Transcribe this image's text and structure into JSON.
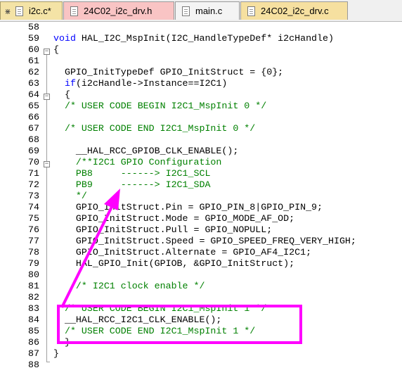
{
  "tabs": [
    {
      "label": "i2c.c*",
      "color": "#f4e3a6",
      "active": true
    },
    {
      "label": "24C02_i2c_drv.h",
      "color": "#f9c4c4"
    },
    {
      "label": "main.c",
      "color": "#f4f4f4"
    },
    {
      "label": "24C02_i2c_drv.c",
      "color": "#f6e0a0"
    }
  ],
  "lines": [
    {
      "n": "58",
      "code": ""
    },
    {
      "n": "59",
      "code": "void HAL_I2C_MspInit(I2C_HandleTypeDef* i2cHandle)"
    },
    {
      "n": "60",
      "code": "{"
    },
    {
      "n": "61",
      "code": ""
    },
    {
      "n": "62",
      "code": "  GPIO_InitTypeDef GPIO_InitStruct = {0};"
    },
    {
      "n": "63",
      "code": "  if(i2cHandle->Instance==I2C1)"
    },
    {
      "n": "64",
      "code": "  {"
    },
    {
      "n": "65",
      "code": "  /* USER CODE BEGIN I2C1_MspInit 0 */"
    },
    {
      "n": "66",
      "code": ""
    },
    {
      "n": "67",
      "code": "  /* USER CODE END I2C1_MspInit 0 */"
    },
    {
      "n": "68",
      "code": ""
    },
    {
      "n": "69",
      "code": "    __HAL_RCC_GPIOB_CLK_ENABLE();"
    },
    {
      "n": "70",
      "code": "    /**I2C1 GPIO Configuration"
    },
    {
      "n": "71",
      "code": "    PB8     ------> I2C1_SCL"
    },
    {
      "n": "72",
      "code": "    PB9     ------> I2C1_SDA"
    },
    {
      "n": "73",
      "code": "    */"
    },
    {
      "n": "74",
      "code": "    GPIO_InitStruct.Pin = GPIO_PIN_8|GPIO_PIN_9;"
    },
    {
      "n": "75",
      "code": "    GPIO_InitStruct.Mode = GPIO_MODE_AF_OD;"
    },
    {
      "n": "76",
      "code": "    GPIO_InitStruct.Pull = GPIO_NOPULL;"
    },
    {
      "n": "77",
      "code": "    GPIO_InitStruct.Speed = GPIO_SPEED_FREQ_VERY_HIGH;"
    },
    {
      "n": "78",
      "code": "    GPIO_InitStruct.Alternate = GPIO_AF4_I2C1;"
    },
    {
      "n": "79",
      "code": "    HAL_GPIO_Init(GPIOB, &GPIO_InitStruct);"
    },
    {
      "n": "80",
      "code": ""
    },
    {
      "n": "81",
      "code": "    /* I2C1 clock enable */"
    },
    {
      "n": "82",
      "code": ""
    },
    {
      "n": "83",
      "code": "  /* USER CODE BEGIN I2C1_MspInit 1 */"
    },
    {
      "n": "84",
      "code": "  __HAL_RCC_I2C1_CLK_ENABLE();"
    },
    {
      "n": "85",
      "code": "  /* USER CODE END I2C1_MspInit 1 */"
    },
    {
      "n": "86",
      "code": "  }"
    },
    {
      "n": "87",
      "code": "}"
    },
    {
      "n": "88",
      "code": ""
    }
  ],
  "colors": {
    "keyword": "#0000ff",
    "comment": "#008000",
    "annotation": "#ff00ff"
  }
}
